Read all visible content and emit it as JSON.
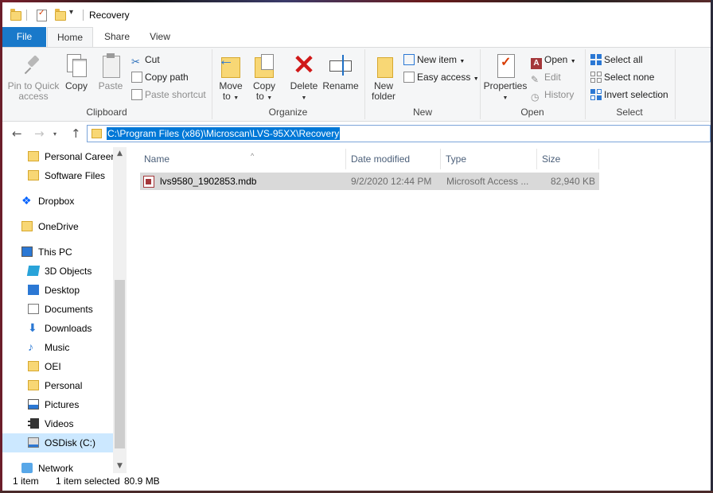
{
  "window": {
    "title": "Recovery"
  },
  "ribbon_tabs": {
    "file": "File",
    "home": "Home",
    "share": "Share",
    "view": "View"
  },
  "clipboard": {
    "pin": "Pin to Quick access",
    "pin_line1": "Pin to Quick",
    "pin_line2": "access",
    "copy": "Copy",
    "paste": "Paste",
    "cut": "Cut",
    "copy_path": "Copy path",
    "paste_shortcut": "Paste shortcut",
    "group": "Clipboard"
  },
  "organize": {
    "move_to_line1": "Move",
    "move_to_line2": "to",
    "copy_to_line1": "Copy",
    "copy_to_line2": "to",
    "delete": "Delete",
    "rename": "Rename",
    "group": "Organize"
  },
  "new": {
    "new_folder_line1": "New",
    "new_folder_line2": "folder",
    "new_item": "New item",
    "easy_access": "Easy access",
    "group": "New"
  },
  "open": {
    "properties": "Properties",
    "open": "Open",
    "edit": "Edit",
    "history": "History",
    "group": "Open"
  },
  "select": {
    "select_all": "Select all",
    "select_none": "Select none",
    "invert_selection": "Invert selection",
    "group": "Select"
  },
  "address": {
    "path": "C:\\Program Files (x86)\\Microscan\\LVS-95XX\\Recovery"
  },
  "nav": {
    "items": [
      {
        "label": "Personal Career",
        "icon": "folder-icon"
      },
      {
        "label": "Software Files",
        "icon": "folder-icon"
      },
      {
        "label": "Dropbox",
        "icon": "dropbox-icon"
      },
      {
        "label": "OneDrive",
        "icon": "folder-icon"
      },
      {
        "label": "This PC",
        "icon": "computer-icon"
      },
      {
        "label": "3D Objects",
        "icon": "3d-objects-icon"
      },
      {
        "label": "Desktop",
        "icon": "desktop-icon"
      },
      {
        "label": "Documents",
        "icon": "documents-icon"
      },
      {
        "label": "Downloads",
        "icon": "download-icon"
      },
      {
        "label": "Music",
        "icon": "music-icon"
      },
      {
        "label": "OEI",
        "icon": "folder-icon"
      },
      {
        "label": "Personal",
        "icon": "folder-icon"
      },
      {
        "label": "Pictures",
        "icon": "pictures-icon"
      },
      {
        "label": "Videos",
        "icon": "videos-icon"
      },
      {
        "label": "OSDisk (C:)",
        "icon": "disk-icon"
      },
      {
        "label": "Network",
        "icon": "network-icon"
      }
    ]
  },
  "columns": {
    "name": "Name",
    "date": "Date modified",
    "type": "Type",
    "size": "Size"
  },
  "files": [
    {
      "name": "lvs9580_1902853.mdb",
      "date": "9/2/2020 12:44 PM",
      "type": "Microsoft Access ...",
      "size": "82,940 KB"
    }
  ],
  "status": {
    "items": "1 item",
    "selected": "1 item selected",
    "size": "80.9 MB"
  },
  "colors": {
    "accent": "#1979ca",
    "selection": "#0078d7",
    "row_selected": "#d9d9d9",
    "nav_selected": "#cce8ff"
  }
}
